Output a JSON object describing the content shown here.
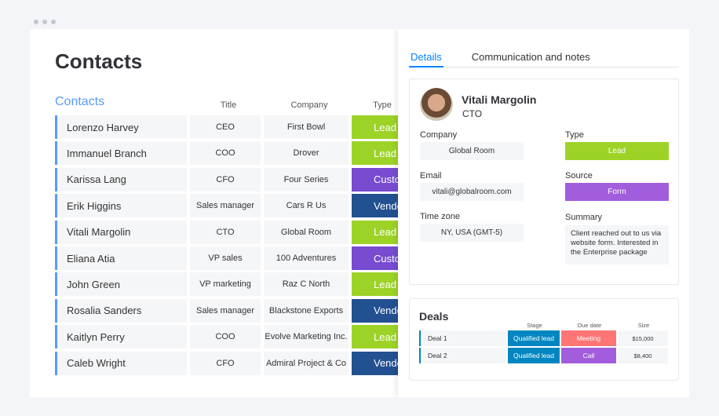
{
  "page": {
    "title": "Contacts",
    "group": "Contacts"
  },
  "columns": {
    "title": "Title",
    "company": "Company",
    "type": "Type"
  },
  "rows": [
    {
      "name": "Lorenzo Harvey",
      "title": "CEO",
      "company": "First Bowl",
      "type": "Lead"
    },
    {
      "name": "Immanuel Branch",
      "title": "COO",
      "company": "Drover",
      "type": "Lead"
    },
    {
      "name": "Karissa Lang",
      "title": "CFO",
      "company": "Four Series",
      "type": "Customer"
    },
    {
      "name": "Erik Higgins",
      "title": "Sales manager",
      "company": "Cars R Us",
      "type": "Vendor"
    },
    {
      "name": "Vitali Margolin",
      "title": "CTO",
      "company": "Global Room",
      "type": "Lead"
    },
    {
      "name": "Eliana Atia",
      "title": "VP sales",
      "company": "100 Adventures",
      "type": "Customer"
    },
    {
      "name": "John Green",
      "title": "VP marketing",
      "company": "Raz C North",
      "type": "Lead"
    },
    {
      "name": "Rosalia Sanders",
      "title": "Sales manager",
      "company": "Blackstone Exports",
      "type": "Vendor"
    },
    {
      "name": "Kaitlyn Perry",
      "title": "COO",
      "company": "Evolve Marketing Inc.",
      "type": "Lead"
    },
    {
      "name": "Caleb Wright",
      "title": "CFO",
      "company": "Admiral Project & Co",
      "type": "Vendor"
    }
  ],
  "type_colors": {
    "Lead": "#9cd326",
    "Customer": "#784bd1",
    "Vendor": "#225091"
  },
  "panel": {
    "tabs": [
      "Details",
      "Communication and notes"
    ],
    "person": {
      "name": "Vitali Margolin",
      "title": "CTO"
    },
    "fields": {
      "company_label": "Company",
      "company": "Global Room",
      "email_label": "Email",
      "email": "vitali@globalroom.com",
      "timezone_label": "Time zone",
      "timezone": "NY, USA (GMT-5)",
      "type_label": "Type",
      "type": "Lead",
      "source_label": "Source",
      "source": "Form",
      "summary_label": "Summary",
      "summary": "Client reached out to us via website form. Interested in the Enterprise package"
    },
    "deals": {
      "title": "Deals",
      "headers": {
        "stage": "Stage",
        "due": "Due date",
        "size": "Size"
      },
      "items": [
        {
          "name": "Deal 1",
          "stage": "Qualified lead",
          "due": "Meeting",
          "due_color": "#ff7575",
          "size": "$15,000"
        },
        {
          "name": "Deal 2",
          "stage": "Qualified lead",
          "due": "Call",
          "due_color": "#a25ddc",
          "size": "$8,400"
        }
      ]
    }
  }
}
